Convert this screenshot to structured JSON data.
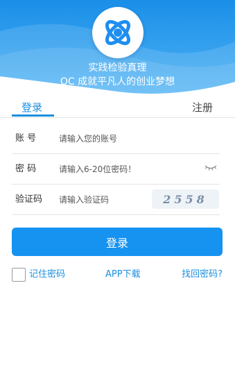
{
  "header": {
    "slogan_line1": "实践检验真理",
    "slogan_line2": "OC 成就平凡人的创业梦想",
    "logo_icon": "logo-icon"
  },
  "tabs": {
    "login": "登录",
    "register": "注册"
  },
  "form": {
    "account": {
      "label": "账 号",
      "placeholder": "请输入您的账号",
      "value": ""
    },
    "password": {
      "label": "密 码",
      "placeholder": "请输入6-20位密码！",
      "value": "",
      "toggle_icon": "eye-closed-icon"
    },
    "captcha": {
      "label": "验证码",
      "placeholder": "请输入验证码",
      "value": "",
      "image_text": "2558"
    }
  },
  "actions": {
    "login_button": "登录",
    "remember_password": "记住密码",
    "remember_checked": false,
    "app_download": "APP下载",
    "forgot_password": "找回密码?"
  },
  "colors": {
    "primary": "#1692f0",
    "accent_text": "#1a8fe0",
    "header_gradient_top": "#1a8fe8",
    "header_gradient_bottom": "#5bb8f5"
  }
}
